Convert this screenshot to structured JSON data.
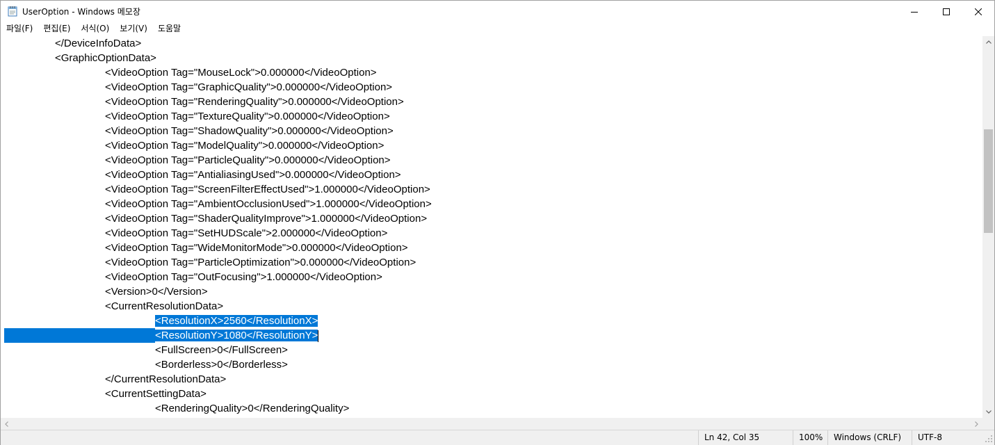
{
  "window": {
    "title": "UserOption - Windows 메모장",
    "icon": "notepad-icon"
  },
  "menu": {
    "items": [
      "파일(F)",
      "편집(E)",
      "서식(O)",
      "보기(V)",
      "도움말"
    ]
  },
  "editor": {
    "lines": [
      {
        "indent": 1,
        "text": "</DeviceInfoData>"
      },
      {
        "indent": 1,
        "text": "<GraphicOptionData>"
      },
      {
        "indent": 2,
        "text": "<VideoOption Tag=\"MouseLock\">0.000000</VideoOption>"
      },
      {
        "indent": 2,
        "text": "<VideoOption Tag=\"GraphicQuality\">0.000000</VideoOption>"
      },
      {
        "indent": 2,
        "text": "<VideoOption Tag=\"RenderingQuality\">0.000000</VideoOption>"
      },
      {
        "indent": 2,
        "text": "<VideoOption Tag=\"TextureQuality\">0.000000</VideoOption>"
      },
      {
        "indent": 2,
        "text": "<VideoOption Tag=\"ShadowQuality\">0.000000</VideoOption>"
      },
      {
        "indent": 2,
        "text": "<VideoOption Tag=\"ModelQuality\">0.000000</VideoOption>"
      },
      {
        "indent": 2,
        "text": "<VideoOption Tag=\"ParticleQuality\">0.000000</VideoOption>"
      },
      {
        "indent": 2,
        "text": "<VideoOption Tag=\"AntialiasingUsed\">0.000000</VideoOption>"
      },
      {
        "indent": 2,
        "text": "<VideoOption Tag=\"ScreenFilterEffectUsed\">1.000000</VideoOption>"
      },
      {
        "indent": 2,
        "text": "<VideoOption Tag=\"AmbientOcclusionUsed\">1.000000</VideoOption>"
      },
      {
        "indent": 2,
        "text": "<VideoOption Tag=\"ShaderQualityImprove\">1.000000</VideoOption>"
      },
      {
        "indent": 2,
        "text": "<VideoOption Tag=\"SetHUDScale\">2.000000</VideoOption>"
      },
      {
        "indent": 2,
        "text": "<VideoOption Tag=\"WideMonitorMode\">0.000000</VideoOption>"
      },
      {
        "indent": 2,
        "text": "<VideoOption Tag=\"ParticleOptimization\">0.000000</VideoOption>"
      },
      {
        "indent": 2,
        "text": "<VideoOption Tag=\"OutFocusing\">1.000000</VideoOption>"
      },
      {
        "indent": 2,
        "text": "<Version>0</Version>"
      },
      {
        "indent": 2,
        "text": "<CurrentResolutionData>"
      },
      {
        "indent": 3,
        "text": "<ResolutionX>2560</ResolutionX>",
        "selected": true
      },
      {
        "indent": 3,
        "text": "<ResolutionY>1080</ResolutionY>",
        "selected": true,
        "selected_lead": true,
        "caret": true
      },
      {
        "indent": 3,
        "text": "<FullScreen>0</FullScreen>"
      },
      {
        "indent": 3,
        "text": "<Borderless>0</Borderless>"
      },
      {
        "indent": 2,
        "text": "</CurrentResolutionData>"
      },
      {
        "indent": 2,
        "text": "<CurrentSettingData>"
      },
      {
        "indent": 3,
        "text": "<RenderingQuality>0</RenderingQuality>"
      }
    ]
  },
  "status": {
    "position": "Ln 42, Col 35",
    "zoom": "100%",
    "line_ending": "Windows (CRLF)",
    "encoding": "UTF-8"
  },
  "colors": {
    "selection": "#0078d7",
    "selection_text": "#ffffff",
    "scrollbar_track": "#f0f0f0",
    "scrollbar_thumb": "#c2c2c2"
  }
}
